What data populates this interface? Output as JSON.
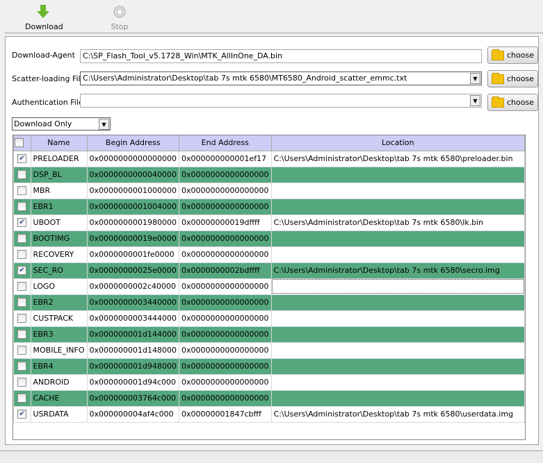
{
  "toolbar": {
    "download": "Download",
    "stop": "Stop"
  },
  "form": {
    "download_agent_label": "Download-Agent",
    "download_agent_value": "C:\\SP_Flash_Tool_v5.1728_Win\\MTK_AllInOne_DA.bin",
    "scatter_label": "Scatter-loading File",
    "scatter_value": "C:\\Users\\Administrator\\Desktop\\tab 7s mtk 6580\\MT6580_Android_scatter_emmc.txt",
    "auth_label": "Authentication File",
    "auth_value": "",
    "choose_label": "choose",
    "mode": "Download Only"
  },
  "table": {
    "headers": [
      "Name",
      "Begin Address",
      "End Address",
      "Location"
    ],
    "rows": [
      {
        "checked": true,
        "name": "PRELOADER",
        "begin": "0x0000000000000000",
        "end": "0x000000000001ef17",
        "location": "C:\\Users\\Administrator\\Desktop\\tab 7s mtk 6580\\preloader.bin"
      },
      {
        "checked": false,
        "name": "DSP_BL",
        "begin": "0x0000000000040000",
        "end": "0x0000000000000000",
        "location": ""
      },
      {
        "checked": false,
        "name": "MBR",
        "begin": "0x0000000001000000",
        "end": "0x0000000000000000",
        "location": ""
      },
      {
        "checked": false,
        "name": "EBR1",
        "begin": "0x0000000001004000",
        "end": "0x0000000000000000",
        "location": ""
      },
      {
        "checked": true,
        "name": "UBOOT",
        "begin": "0x0000000001980000",
        "end": "0x00000000019dffff",
        "location": "C:\\Users\\Administrator\\Desktop\\tab 7s mtk 6580\\lk.bin"
      },
      {
        "checked": false,
        "name": "BOOTIMG",
        "begin": "0x00000000019e0000",
        "end": "0x0000000000000000",
        "location": ""
      },
      {
        "checked": false,
        "name": "RECOVERY",
        "begin": "0x0000000001fe0000",
        "end": "0x0000000000000000",
        "location": ""
      },
      {
        "checked": true,
        "name": "SEC_RO",
        "begin": "0x00000000025e0000",
        "end": "0x0000000002bdffff",
        "location": "C:\\Users\\Administrator\\Desktop\\tab 7s mtk 6580\\secro.img"
      },
      {
        "checked": false,
        "name": "LOGO",
        "begin": "0x0000000002c40000",
        "end": "0x0000000000000000",
        "location": ""
      },
      {
        "checked": false,
        "name": "EBR2",
        "begin": "0x0000000003440000",
        "end": "0x0000000000000000",
        "location": ""
      },
      {
        "checked": false,
        "name": "CUSTPACK",
        "begin": "0x0000000003444000",
        "end": "0x0000000000000000",
        "location": ""
      },
      {
        "checked": false,
        "name": "EBR3",
        "begin": "0x000000001d144000",
        "end": "0x0000000000000000",
        "location": ""
      },
      {
        "checked": false,
        "name": "MOBILE_INFO",
        "begin": "0x000000001d148000",
        "end": "0x0000000000000000",
        "location": ""
      },
      {
        "checked": false,
        "name": "EBR4",
        "begin": "0x000000001d948000",
        "end": "0x0000000000000000",
        "location": ""
      },
      {
        "checked": false,
        "name": "ANDROID",
        "begin": "0x000000001d94c000",
        "end": "0x0000000000000000",
        "location": ""
      },
      {
        "checked": false,
        "name": "CACHE",
        "begin": "0x000000003764c000",
        "end": "0x0000000000000000",
        "location": ""
      },
      {
        "checked": true,
        "name": "USRDATA",
        "begin": "0x000000004af4c000",
        "end": "0x00000001847cbfff",
        "location": "C:\\Users\\Administrator\\Desktop\\tab 7s mtk 6580\\userdata.img"
      }
    ]
  },
  "colors": {
    "row_alt": "#55a87d",
    "header": "#ccccf5",
    "download_icon": "#6ab82c"
  }
}
